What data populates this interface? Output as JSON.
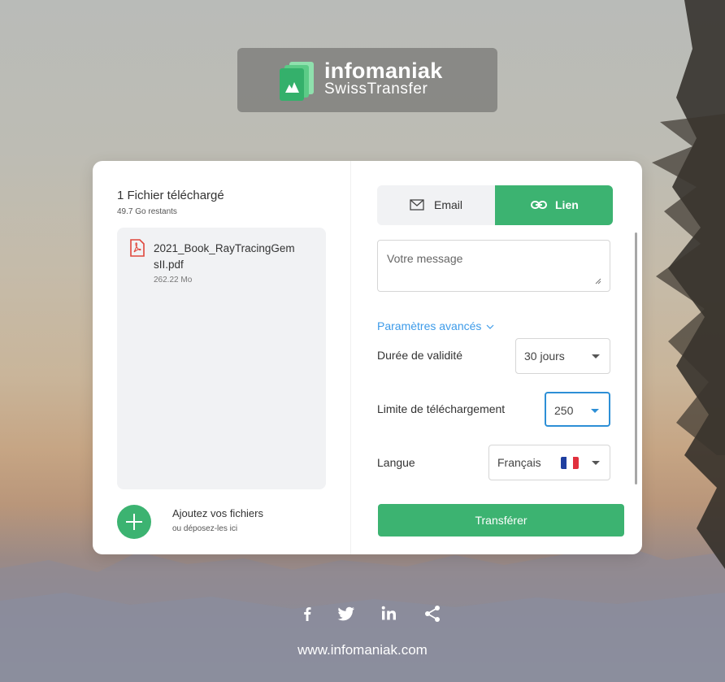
{
  "logo": {
    "title": "infomaniak",
    "subtitle": "SwissTransfer"
  },
  "files": {
    "title": "1 Fichier téléchargé",
    "remaining": "49.7 Go restants",
    "items": [
      {
        "name": "2021_Book_RayTracingGemsII.pdf",
        "size": "262.22 Mo",
        "icon": "pdf-icon"
      }
    ]
  },
  "add": {
    "title": "Ajoutez vos fichiers",
    "subtitle": "ou déposez-les ici"
  },
  "tabs": [
    {
      "label": "Email",
      "icon": "mail-icon",
      "active": false
    },
    {
      "label": "Lien",
      "icon": "link-icon",
      "active": true
    }
  ],
  "message": {
    "placeholder": "Votre message",
    "value": ""
  },
  "advanced": {
    "label": "Paramètres avancés"
  },
  "settings": {
    "validity": {
      "label": "Durée de validité",
      "value": "30 jours"
    },
    "download_limit": {
      "label": "Limite de téléchargement",
      "value": "250"
    },
    "language": {
      "label": "Langue",
      "value": "Français",
      "flag": "fr-flag"
    }
  },
  "transfer_button": "Transférer",
  "footer": {
    "social": [
      "facebook-icon",
      "twitter-icon",
      "linkedin-icon",
      "share-icon"
    ],
    "link": "www.infomaniak.com"
  },
  "colors": {
    "accent": "#3cb371",
    "link": "#3d9be9",
    "focus": "#2d8fd6"
  }
}
